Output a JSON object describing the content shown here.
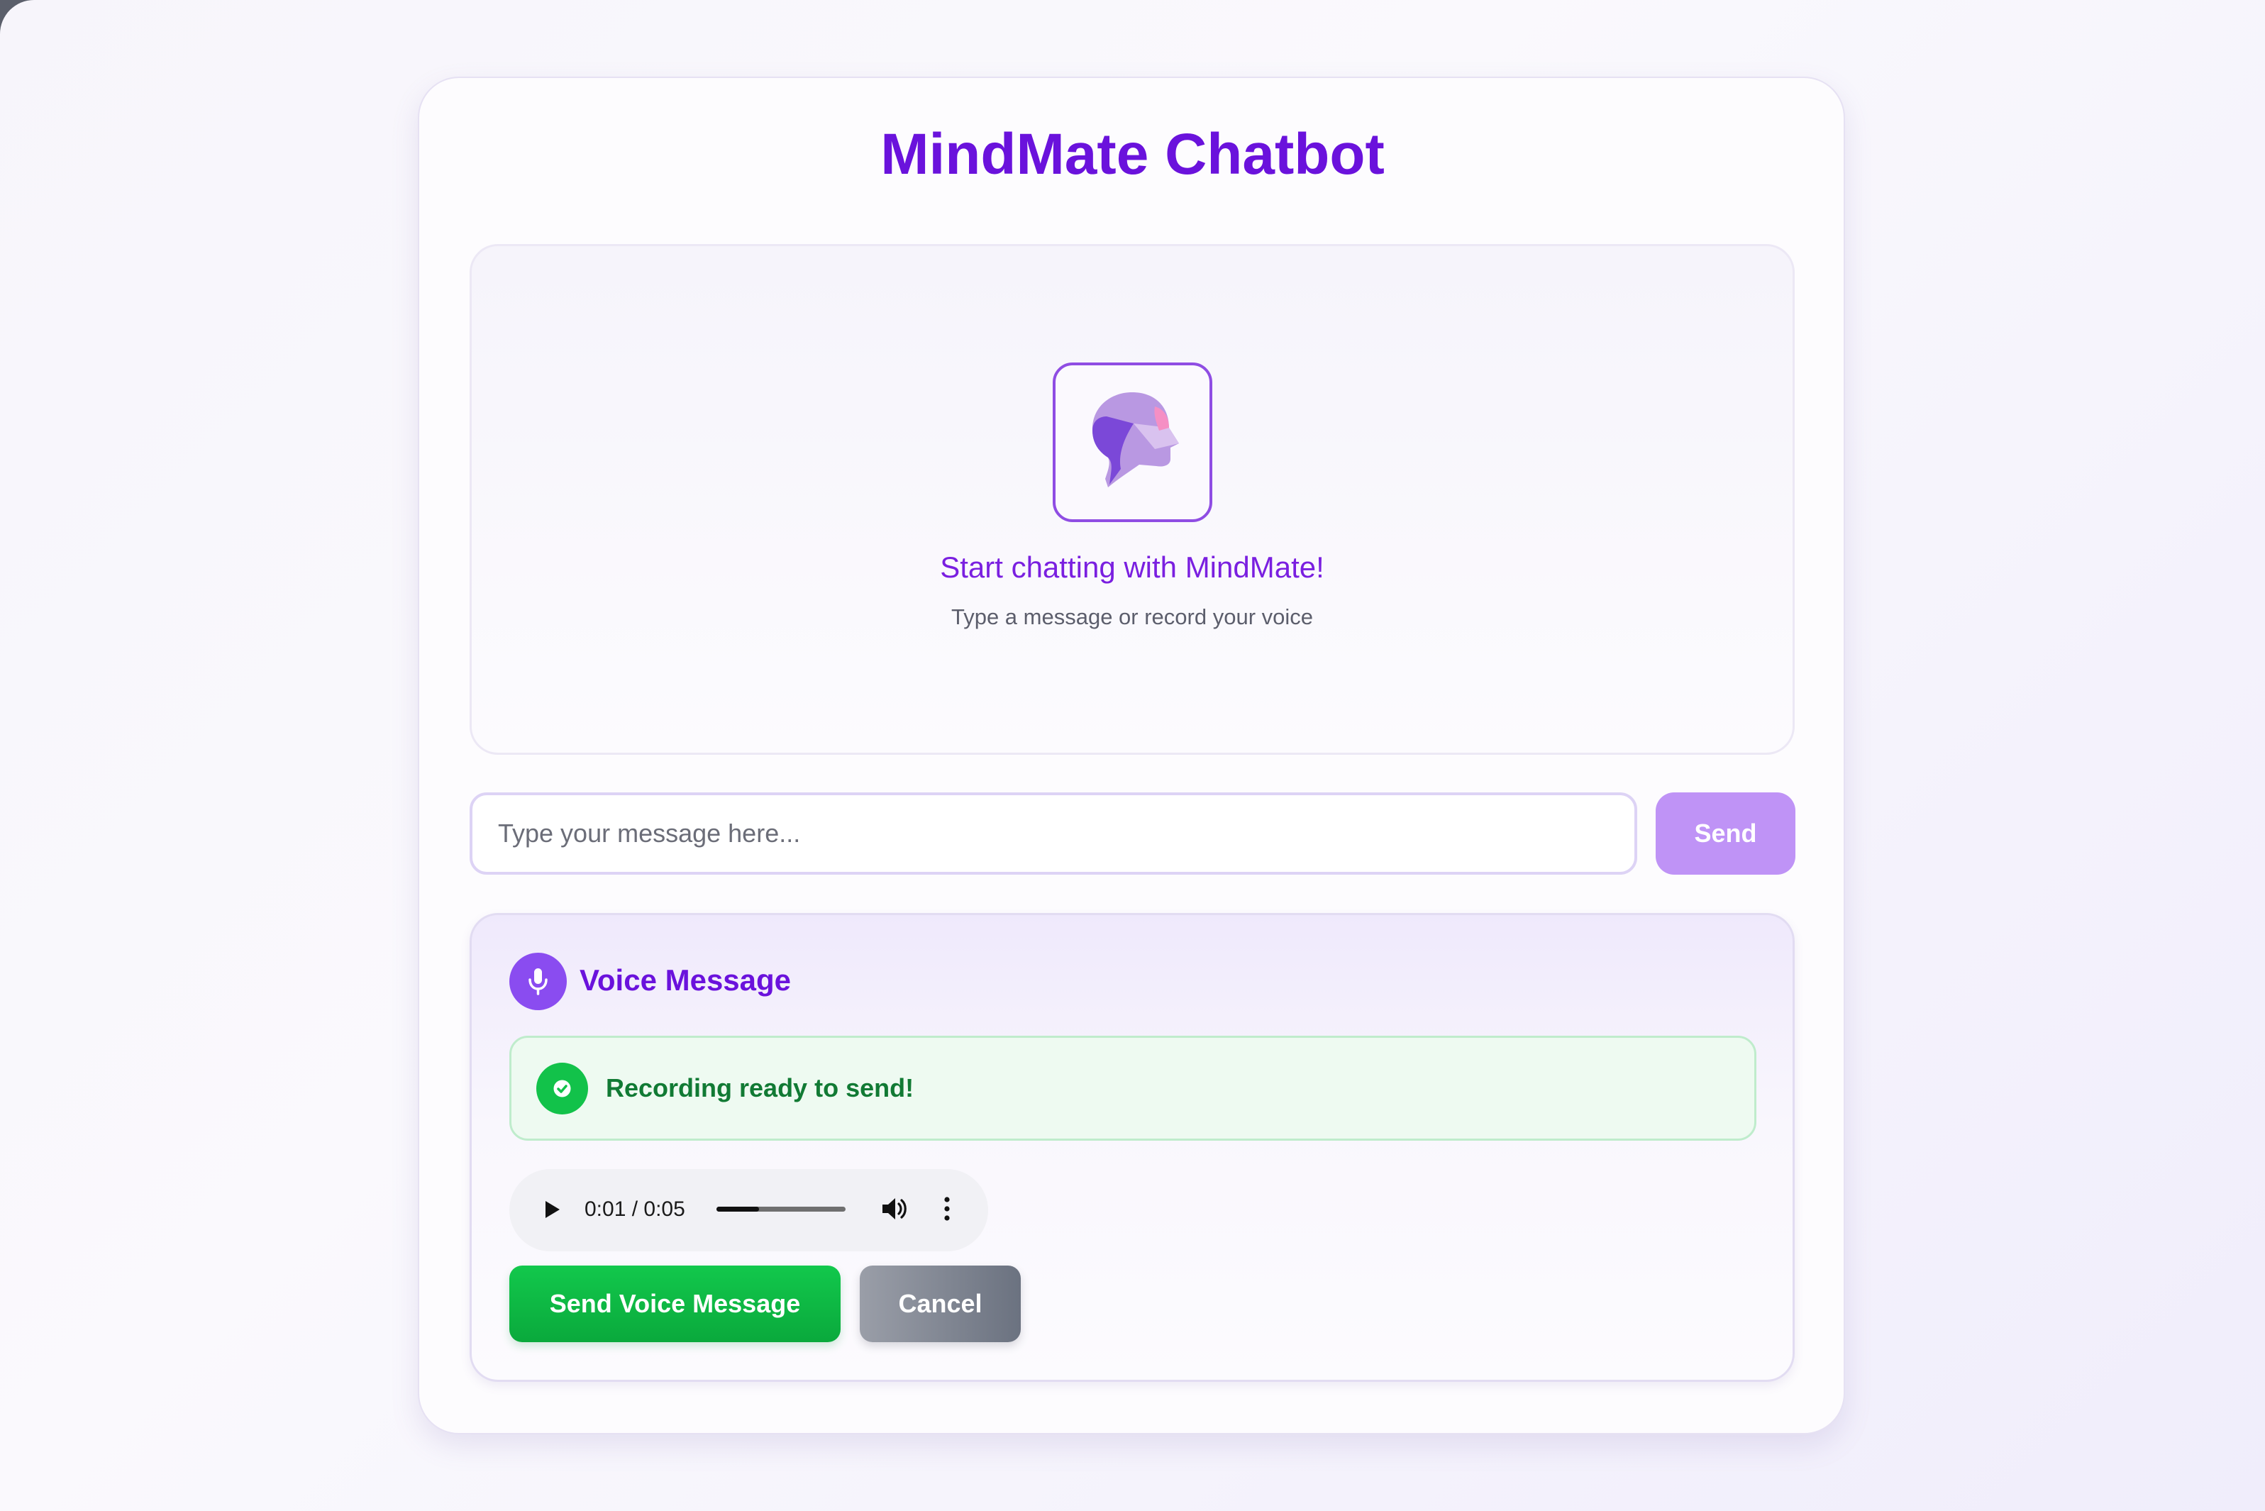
{
  "app": {
    "title": "MindMate Chatbot"
  },
  "chat": {
    "empty_title": "Start chatting with MindMate!",
    "empty_subtitle": "Type a message or record your voice",
    "logo_icon": "brain-head-icon"
  },
  "composer": {
    "placeholder": "Type your message here...",
    "value": "",
    "send_label": "Send"
  },
  "voice": {
    "title": "Voice Message",
    "icon": "microphone-icon",
    "status_text": "Recording ready to send!",
    "status_icon": "check-circle-icon",
    "player": {
      "time_label": "0:01 / 0:05",
      "progress": 0.2
    },
    "send_label": "Send Voice Message",
    "cancel_label": "Cancel"
  },
  "colors": {
    "accent": "#6a12dc",
    "send_button": "#bf93f6",
    "success": "#12c24a",
    "success_text": "#117a34",
    "cancel": "#6b7280"
  }
}
